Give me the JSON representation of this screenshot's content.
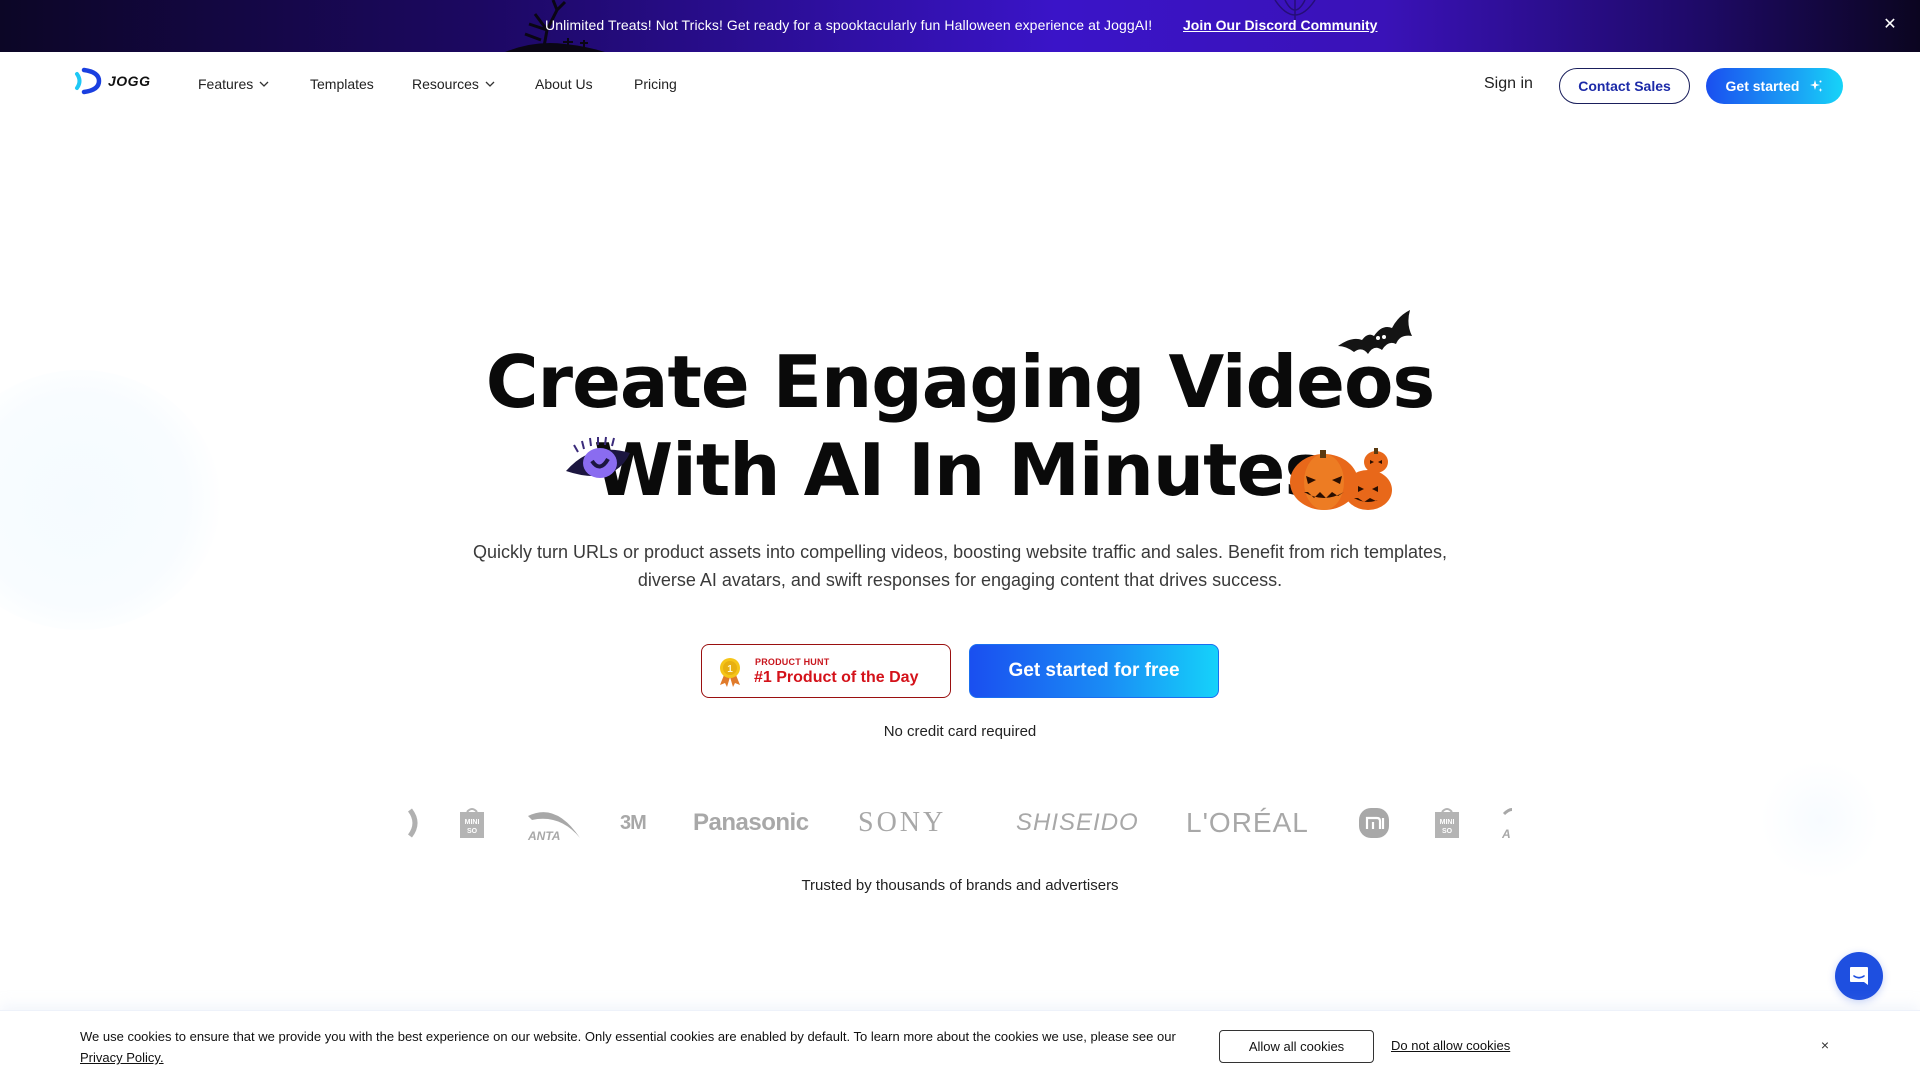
{
  "banner": {
    "message": "Unlimited Treats! Not Tricks! Get ready for a spooktacularly fun Halloween experience at JoggAI!",
    "link_label": "Join Our Discord Community",
    "close_icon": "close-icon",
    "close_glyph": "✕"
  },
  "nav": {
    "logo_text": "JOGG",
    "items": [
      {
        "label": "Features",
        "has_dropdown": true
      },
      {
        "label": "Templates",
        "has_dropdown": false
      },
      {
        "label": "Resources",
        "has_dropdown": true
      },
      {
        "label": "About Us",
        "has_dropdown": false
      },
      {
        "label": "Pricing",
        "has_dropdown": false
      }
    ],
    "sign_in": "Sign in",
    "contact_sales": "Contact Sales",
    "get_started": "Get started",
    "get_started_icon": "sparkle-icon"
  },
  "hero": {
    "title_line1": "Create Engaging Videos",
    "title_line2": "With AI In Minutes",
    "subtitle": "Quickly turn URLs or product assets into compelling videos, boosting website traffic and sales. Benefit from rich templates, diverse AI avatars, and swift responses for engaging content that drives success.",
    "badge_small": "PRODUCT HUNT",
    "badge_big": "#1 Product of the Day",
    "badge_medal_number": "1",
    "cta_label": "Get started for free",
    "no_credit_card": "No credit card required",
    "decorations": [
      "bat-icon",
      "eye-icon",
      "pumpkins-icon"
    ]
  },
  "brands": {
    "logos": [
      "partial-logo",
      "MINISO",
      "ANTA",
      "3M",
      "Panasonic",
      "SONY",
      "SHISEIDO",
      "L'ORÉAL",
      "mi",
      "MINISO",
      "ANTA"
    ],
    "caption": "Trusted by thousands of brands and advertisers"
  },
  "cookie_banner": {
    "text": "We use cookies to ensure that we provide you with the best experience on our website. Only essential cookies are enabled by default. To learn more about the cookies we use, please see our ",
    "policy_link": "Privacy Policy.",
    "allow_label": "Allow all cookies",
    "deny_label": "Do not allow cookies",
    "close_glyph": "×"
  },
  "colors": {
    "brand_blue": "#1a4ff0",
    "brand_cyan": "#16d4f8",
    "banner_purple": "#3a14c8",
    "product_hunt_red": "#d4121a",
    "chat_blue": "#1e4fe0"
  }
}
